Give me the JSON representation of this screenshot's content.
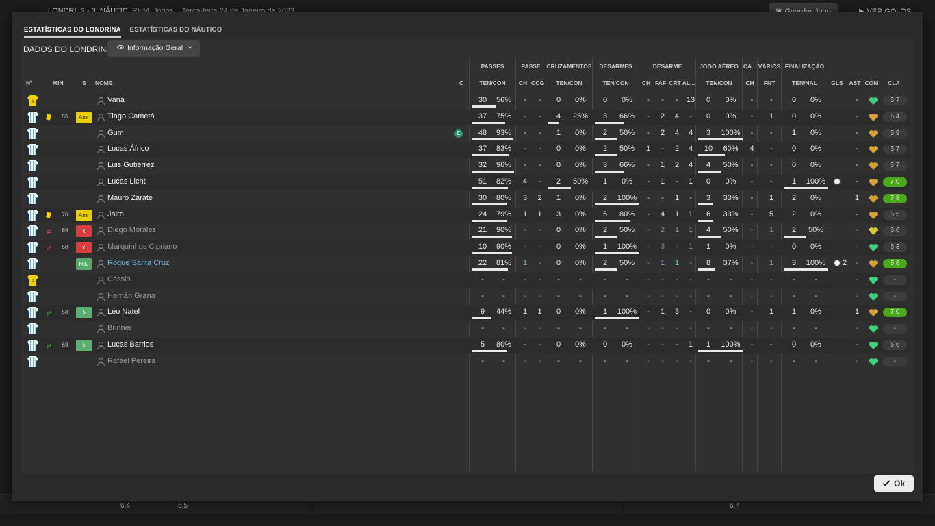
{
  "background": {
    "header": {
      "team_a": "LONDRI",
      "score": "2 - 3",
      "team_b": "NÁUTIC",
      "rhm": "RHM, Jogos",
      "date": "Terça-feira 24 de Janeiro de 2023"
    },
    "save_button": "Guardar Jogo",
    "goals_button": "VER GOLOS",
    "bottom_values": [
      "6,4",
      "6,5",
      "6,7"
    ]
  },
  "tabs": [
    "ESTATÍSTICAS DO LONDRINA",
    "ESTATÍSTICAS DO NÁUTICO"
  ],
  "team_label": "DADOS DO LONDRINA",
  "view_dropdown": "Informação Geral",
  "headers": {
    "groups": [
      "PASSES",
      "PASSE",
      "CRUZAMENTOS",
      "DESARMES",
      "DESARME",
      "JOGO AÉREO",
      "CA...",
      "VÁRIOS",
      "FINALIZAÇÃO"
    ],
    "left": [
      "Nº",
      "MIN",
      "S",
      "NOME",
      "C"
    ],
    "sub": [
      "TEN/CON",
      "CH",
      "OCG",
      "TEN/CON",
      "TEN/CON",
      "CH",
      "FAF",
      "CRT",
      "AL...",
      "TEN/CON",
      "CH",
      "FNT",
      "TEN/NAL",
      "GLS",
      "AST",
      "CON",
      "CLA"
    ]
  },
  "players": [
    {
      "name": "Vaná",
      "card": "",
      "min": "",
      "pos": "",
      "cap": false,
      "style": "",
      "pt": "30",
      "pp": "56%",
      "pch": "-",
      "ocg": "-",
      "ct": "0",
      "cp": "0%",
      "dt": "0",
      "dp": "0%",
      "dch": "-",
      "faf": "-",
      "crt": "-",
      "al": "13",
      "at": "0",
      "ap": "0%",
      "cach": "-",
      "fnt": "-",
      "ft": "0",
      "fp": "0%",
      "gls": "",
      "ast": "-",
      "rating": "6.7",
      "good": false,
      "ball": false,
      "keeper": true,
      "pbar": 0.56,
      "cbar": 0,
      "dbar": 0,
      "abar": 0,
      "fbar": 0
    },
    {
      "name": "Tiago Cametá",
      "card": "yellow",
      "min": "55",
      "pos": "Amr",
      "cap": false,
      "style": "",
      "pt": "37",
      "pp": "75%",
      "pch": "-",
      "ocg": "-",
      "ct": "4",
      "cp": "25%",
      "dt": "3",
      "dp": "66%",
      "dch": "-",
      "faf": "2",
      "crt": "4",
      "al": "-",
      "at": "0",
      "ap": "0%",
      "cach": "-",
      "fnt": "1",
      "ft": "0",
      "fp": "0%",
      "gls": "",
      "ast": "-",
      "rating": "6.4",
      "good": false,
      "ball": false,
      "keeper": false,
      "pbar": 0.75,
      "cbar": 0.25,
      "dbar": 0.66,
      "abar": 0,
      "fbar": 0
    },
    {
      "name": "Gum",
      "card": "",
      "min": "",
      "pos": "",
      "cap": true,
      "style": "",
      "pt": "48",
      "pp": "93%",
      "pch": "-",
      "ocg": "-",
      "ct": "1",
      "cp": "0%",
      "dt": "2",
      "dp": "50%",
      "dch": "-",
      "faf": "2",
      "crt": "4",
      "al": "4",
      "at": "3",
      "ap": "100%",
      "cach": "-",
      "fnt": "-",
      "ft": "1",
      "fp": "0%",
      "gls": "",
      "ast": "-",
      "rating": "6.9",
      "good": false,
      "ball": false,
      "keeper": false,
      "pbar": 0.93,
      "cbar": 0,
      "dbar": 0.5,
      "abar": 1,
      "fbar": 0
    },
    {
      "name": "Lucas Áfrico",
      "card": "",
      "min": "",
      "pos": "",
      "cap": false,
      "style": "",
      "pt": "37",
      "pp": "83%",
      "pch": "-",
      "ocg": "-",
      "ct": "0",
      "cp": "0%",
      "dt": "2",
      "dp": "50%",
      "dch": "1",
      "faf": "-",
      "crt": "2",
      "al": "4",
      "at": "10",
      "ap": "60%",
      "cach": "4",
      "fnt": "-",
      "ft": "0",
      "fp": "0%",
      "gls": "",
      "ast": "-",
      "rating": "6.7",
      "good": false,
      "ball": false,
      "keeper": false,
      "pbar": 0.83,
      "cbar": 0,
      "dbar": 0.5,
      "abar": 0.6,
      "fbar": 0
    },
    {
      "name": "Luis Gutiérrez",
      "card": "",
      "min": "",
      "pos": "",
      "cap": false,
      "style": "",
      "pt": "32",
      "pp": "96%",
      "pch": "-",
      "ocg": "-",
      "ct": "0",
      "cp": "0%",
      "dt": "3",
      "dp": "66%",
      "dch": "-",
      "faf": "1",
      "crt": "2",
      "al": "4",
      "at": "4",
      "ap": "50%",
      "cach": "-",
      "fnt": "-",
      "ft": "0",
      "fp": "0%",
      "gls": "",
      "ast": "-",
      "rating": "6.7",
      "good": false,
      "ball": false,
      "keeper": false,
      "pbar": 0.96,
      "cbar": 0,
      "dbar": 0.66,
      "abar": 0.5,
      "fbar": 0
    },
    {
      "name": "Lucas Licht",
      "card": "",
      "min": "",
      "pos": "",
      "cap": false,
      "style": "",
      "pt": "51",
      "pp": "82%",
      "pch": "4",
      "ocg": "-",
      "ct": "2",
      "cp": "50%",
      "dt": "1",
      "dp": "0%",
      "dch": "-",
      "faf": "1",
      "crt": "-",
      "al": "1",
      "at": "0",
      "ap": "0%",
      "cach": "-",
      "fnt": "-",
      "ft": "1",
      "fp": "100%",
      "gls": "",
      "ast": "-",
      "rating": "7.0",
      "good": true,
      "ball": true,
      "keeper": false,
      "pbar": 0.82,
      "cbar": 0.5,
      "dbar": 0,
      "abar": 0,
      "fbar": 1
    },
    {
      "name": "Mauro Zárate",
      "card": "",
      "min": "",
      "pos": "",
      "cap": false,
      "style": "",
      "pt": "30",
      "pp": "80%",
      "pch": "3",
      "ocg": "2",
      "ct": "1",
      "cp": "0%",
      "dt": "2",
      "dp": "100%",
      "dch": "-",
      "faf": "-",
      "crt": "1",
      "al": "-",
      "at": "3",
      "ap": "33%",
      "cach": "-",
      "fnt": "1",
      "ft": "2",
      "fp": "0%",
      "gls": "",
      "ast": "1",
      "rating": "7.8",
      "good": true,
      "ball": false,
      "keeper": false,
      "pbar": 0.8,
      "cbar": 0,
      "dbar": 1,
      "abar": 0.33,
      "fbar": 0
    },
    {
      "name": "Jairo",
      "card": "yellow",
      "min": "76",
      "pos": "Amr",
      "cap": false,
      "style": "",
      "pt": "24",
      "pp": "79%",
      "pch": "1",
      "ocg": "1",
      "ct": "3",
      "cp": "0%",
      "dt": "5",
      "dp": "80%",
      "dch": "-",
      "faf": "4",
      "crt": "1",
      "al": "1",
      "at": "6",
      "ap": "33%",
      "cach": "-",
      "fnt": "5",
      "ft": "2",
      "fp": "0%",
      "gls": "",
      "ast": "-",
      "rating": "6.5",
      "good": false,
      "ball": false,
      "keeper": false,
      "pbar": 0.79,
      "cbar": 0,
      "dbar": 0.8,
      "abar": 0.33,
      "fbar": 0
    },
    {
      "name": "Diego Morales",
      "card": "out",
      "min": "68",
      "pos": "out",
      "cap": false,
      "style": "dim",
      "pt": "21",
      "pp": "90%",
      "pch": "-",
      "ocg": "-",
      "ct": "0",
      "cp": "0%",
      "dt": "2",
      "dp": "50%",
      "dch": "-",
      "faf": "2",
      "crt": "1",
      "al": "1",
      "at": "4",
      "ap": "50%",
      "cach": "-",
      "fnt": "1",
      "ft": "2",
      "fp": "50%",
      "gls": "",
      "ast": "-",
      "rating": "6.6",
      "good": false,
      "ball": false,
      "keeper": false,
      "pbar": 0.9,
      "cbar": 0,
      "dbar": 0.5,
      "abar": 0.5,
      "fbar": 0.5
    },
    {
      "name": "Marquinhos Cipriano",
      "card": "out",
      "min": "58",
      "pos": "out",
      "cap": false,
      "style": "dim",
      "pt": "10",
      "pp": "90%",
      "pch": "-",
      "ocg": "-",
      "ct": "0",
      "cp": "0%",
      "dt": "1",
      "dp": "100%",
      "dch": "-",
      "faf": "3",
      "crt": "-",
      "al": "1",
      "at": "1",
      "ap": "0%",
      "cach": "-",
      "fnt": "-",
      "ft": "0",
      "fp": "0%",
      "gls": "",
      "ast": "-",
      "rating": "6.3",
      "good": false,
      "ball": false,
      "keeper": false,
      "pbar": 0.9,
      "cbar": 0,
      "dbar": 1,
      "abar": 0,
      "fbar": 0
    },
    {
      "name": "Roque Santa Cruz",
      "card": "",
      "min": "",
      "pos": "HdJ",
      "cap": false,
      "style": "blue",
      "pt": "22",
      "pp": "81%",
      "pch": "1",
      "ocg": "-",
      "ct": "0",
      "cp": "0%",
      "dt": "2",
      "dp": "50%",
      "dch": "-",
      "faf": "1",
      "crt": "1",
      "al": "-",
      "at": "8",
      "ap": "37%",
      "cach": "-",
      "fnt": "1",
      "ft": "3",
      "fp": "100%",
      "gls": "2",
      "ast": "-",
      "rating": "8.8",
      "good": true,
      "ball": true,
      "keeper": false,
      "pbar": 0.81,
      "cbar": 0,
      "dbar": 0.5,
      "abar": 0.37,
      "fbar": 1
    },
    {
      "name": "Cássio",
      "card": "",
      "min": "",
      "pos": "",
      "cap": false,
      "style": "dim",
      "pt": "-",
      "pp": "-",
      "pch": "-",
      "ocg": "-",
      "ct": "-",
      "cp": "-",
      "dt": "-",
      "dp": "-",
      "dch": "-",
      "faf": "-",
      "crt": "-",
      "al": "-",
      "at": "-",
      "ap": "-",
      "cach": "-",
      "fnt": "-",
      "ft": "-",
      "fp": "-",
      "gls": "",
      "ast": "-",
      "rating": "-",
      "good": false,
      "ball": false,
      "keeper": true,
      "pbar": 0,
      "cbar": 0,
      "dbar": 0,
      "abar": 0,
      "fbar": 0
    },
    {
      "name": "Hernán Grana",
      "card": "",
      "min": "",
      "pos": "",
      "cap": false,
      "style": "dim",
      "pt": "-",
      "pp": "-",
      "pch": "-",
      "ocg": "-",
      "ct": "-",
      "cp": "-",
      "dt": "-",
      "dp": "-",
      "dch": "-",
      "faf": "-",
      "crt": "-",
      "al": "-",
      "at": "-",
      "ap": "-",
      "cach": "-",
      "fnt": "-",
      "ft": "-",
      "fp": "-",
      "gls": "",
      "ast": "-",
      "rating": "-",
      "good": false,
      "ball": false,
      "keeper": false,
      "pbar": 0,
      "cbar": 0,
      "dbar": 0,
      "abar": 0,
      "fbar": 0
    },
    {
      "name": "Léo Natel",
      "card": "in",
      "min": "58",
      "pos": "in",
      "cap": false,
      "style": "",
      "pt": "9",
      "pp": "44%",
      "pch": "1",
      "ocg": "1",
      "ct": "0",
      "cp": "0%",
      "dt": "1",
      "dp": "100%",
      "dch": "-",
      "faf": "1",
      "crt": "3",
      "al": "-",
      "at": "0",
      "ap": "0%",
      "cach": "-",
      "fnt": "1",
      "ft": "1",
      "fp": "0%",
      "gls": "",
      "ast": "1",
      "rating": "7.0",
      "good": true,
      "ball": false,
      "keeper": false,
      "pbar": 0.44,
      "cbar": 0,
      "dbar": 1,
      "abar": 0,
      "fbar": 0
    },
    {
      "name": "Brinner",
      "card": "",
      "min": "",
      "pos": "",
      "cap": false,
      "style": "dim",
      "pt": "-",
      "pp": "-",
      "pch": "-",
      "ocg": "-",
      "ct": "-",
      "cp": "-",
      "dt": "-",
      "dp": "-",
      "dch": "-",
      "faf": "-",
      "crt": "-",
      "al": "-",
      "at": "-",
      "ap": "-",
      "cach": "-",
      "fnt": "-",
      "ft": "-",
      "fp": "-",
      "gls": "",
      "ast": "-",
      "rating": "-",
      "good": false,
      "ball": false,
      "keeper": false,
      "pbar": 0,
      "cbar": 0,
      "dbar": 0,
      "abar": 0,
      "fbar": 0
    },
    {
      "name": "Lucas Barrios",
      "card": "in",
      "min": "68",
      "pos": "in",
      "cap": false,
      "style": "",
      "pt": "5",
      "pp": "80%",
      "pch": "-",
      "ocg": "-",
      "ct": "0",
      "cp": "0%",
      "dt": "0",
      "dp": "0%",
      "dch": "-",
      "faf": "-",
      "crt": "-",
      "al": "1",
      "at": "1",
      "ap": "100%",
      "cach": "-",
      "fnt": "-",
      "ft": "0",
      "fp": "0%",
      "gls": "",
      "ast": "-",
      "rating": "6.6",
      "good": false,
      "ball": false,
      "keeper": false,
      "pbar": 0.8,
      "cbar": 0,
      "dbar": 0,
      "abar": 1,
      "fbar": 0
    },
    {
      "name": "Rafael Pereira",
      "card": "",
      "min": "",
      "pos": "",
      "cap": false,
      "style": "dim",
      "pt": "-",
      "pp": "-",
      "pch": "-",
      "ocg": "-",
      "ct": "-",
      "cp": "-",
      "dt": "-",
      "dp": "-",
      "dch": "-",
      "faf": "-",
      "crt": "-",
      "al": "-",
      "at": "-",
      "ap": "-",
      "cach": "-",
      "fnt": "-",
      "ft": "-",
      "fp": "-",
      "gls": "",
      "ast": "-",
      "rating": "-",
      "good": false,
      "ball": false,
      "keeper": false,
      "pbar": 0,
      "cbar": 0,
      "dbar": 0,
      "abar": 0,
      "fbar": 0
    }
  ],
  "ok_button": "Ok",
  "colors": {
    "accent_green": "#4aa81c",
    "card_yellow": "#f2d200",
    "sub_red": "#d83c3c",
    "sub_green": "#5ab070",
    "captain": "#2b8f68",
    "highlight_blue": "#6bb8d8"
  }
}
